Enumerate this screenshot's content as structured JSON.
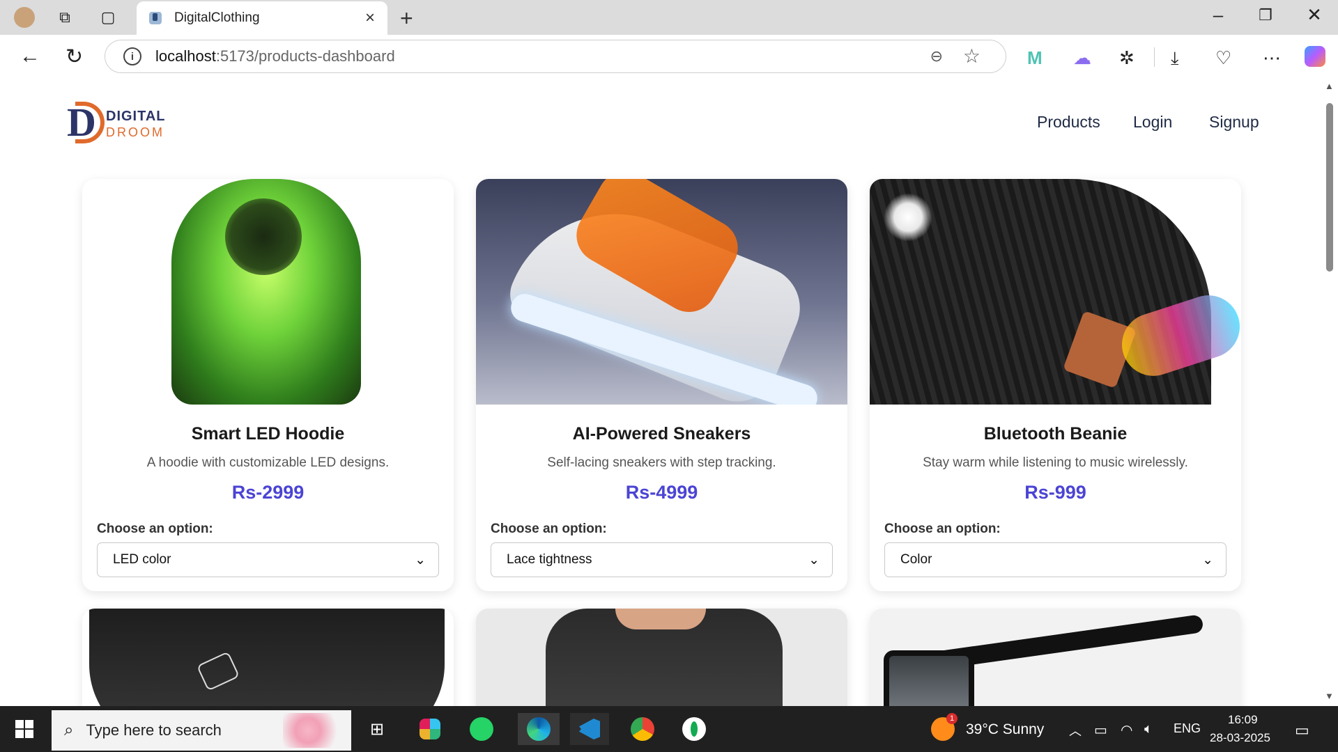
{
  "browser": {
    "tab_title": "DigitalClothing",
    "url_host": "localhost",
    "url_path": ":5173/products-dashboard"
  },
  "site": {
    "logo_line1": "DIGITAL",
    "logo_line2": "DROOM",
    "nav": [
      "Products",
      "Login",
      "Signup"
    ]
  },
  "products": [
    {
      "name": "Smart LED Hoodie",
      "description": "A hoodie with customizable LED designs.",
      "price": "Rs-2999",
      "option_label": "Choose an option:",
      "option_value": "LED color"
    },
    {
      "name": "AI-Powered Sneakers",
      "description": "Self-lacing sneakers with step tracking.",
      "price": "Rs-4999",
      "option_label": "Choose an option:",
      "option_value": "Lace tightness"
    },
    {
      "name": "Bluetooth Beanie",
      "description": "Stay warm while listening to music wirelessly.",
      "price": "Rs-999",
      "option_label": "Choose an option:",
      "option_value": "Color"
    }
  ],
  "taskbar": {
    "search_placeholder": "Type here to search",
    "weather": "39°C  Sunny",
    "language": "ENG",
    "time": "16:09",
    "date": "28-03-2025",
    "weather_badge": "1"
  },
  "colors": {
    "price": "#4b44d4",
    "accent": "#e06a2c",
    "brand": "#2c3467"
  }
}
